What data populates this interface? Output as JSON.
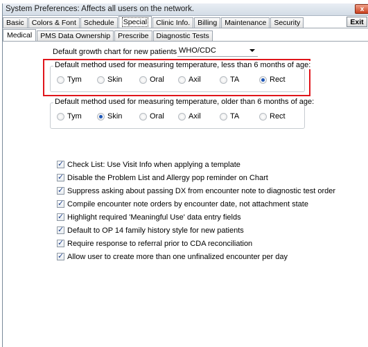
{
  "window": {
    "title": "System Preferences: Affects all users on the network.",
    "close_label": "x",
    "exit_label": "Exit"
  },
  "main_tabs": [
    {
      "label": "Basic",
      "active": false
    },
    {
      "label": "Colors & Font",
      "active": false
    },
    {
      "label": "Schedule",
      "active": false
    },
    {
      "label": "Special",
      "active": true
    },
    {
      "label": "Clinic Info.",
      "active": false
    },
    {
      "label": "Billing",
      "active": false
    },
    {
      "label": "Maintenance",
      "active": false
    },
    {
      "label": "Security",
      "active": false
    }
  ],
  "sub_tabs": [
    {
      "label": "Medical",
      "active": true
    },
    {
      "label": "PMS Data Ownership",
      "active": false
    },
    {
      "label": "Prescribe",
      "active": false
    },
    {
      "label": "Diagnostic Tests",
      "active": false
    }
  ],
  "growth_chart": {
    "label": "Default growth chart for new patients:",
    "value": "WHO/CDC"
  },
  "temp_under6": {
    "legend": "Default method used for measuring temperature, less than 6 months of age:",
    "options": [
      "Tym",
      "Skin",
      "Oral",
      "Axil",
      "TA",
      "Rect"
    ],
    "selected": "Rect"
  },
  "temp_over6": {
    "legend": "Default method used for measuring temperature, older than 6 months of age:",
    "options": [
      "Tym",
      "Skin",
      "Oral",
      "Axil",
      "TA",
      "Rect"
    ],
    "selected": "Skin"
  },
  "checkboxes": [
    {
      "label": "Check List: Use Visit Info when applying a template",
      "checked": true
    },
    {
      "label": "Disable the Problem List and Allergy pop reminder on Chart",
      "checked": true
    },
    {
      "label": "Suppress asking about passing DX from encounter note to diagnostic test order",
      "checked": true
    },
    {
      "label": "Compile encounter note orders by encounter date, not attachment state",
      "checked": true
    },
    {
      "label": "Highlight required 'Meaningful Use' data entry fields",
      "checked": true
    },
    {
      "label": "Default to OP 14 family history style for new patients",
      "checked": true
    },
    {
      "label": "Require response to referral prior to CDA reconciliation",
      "checked": true
    },
    {
      "label": "Allow user to create more than one unfinalized encounter per day",
      "checked": true
    }
  ]
}
